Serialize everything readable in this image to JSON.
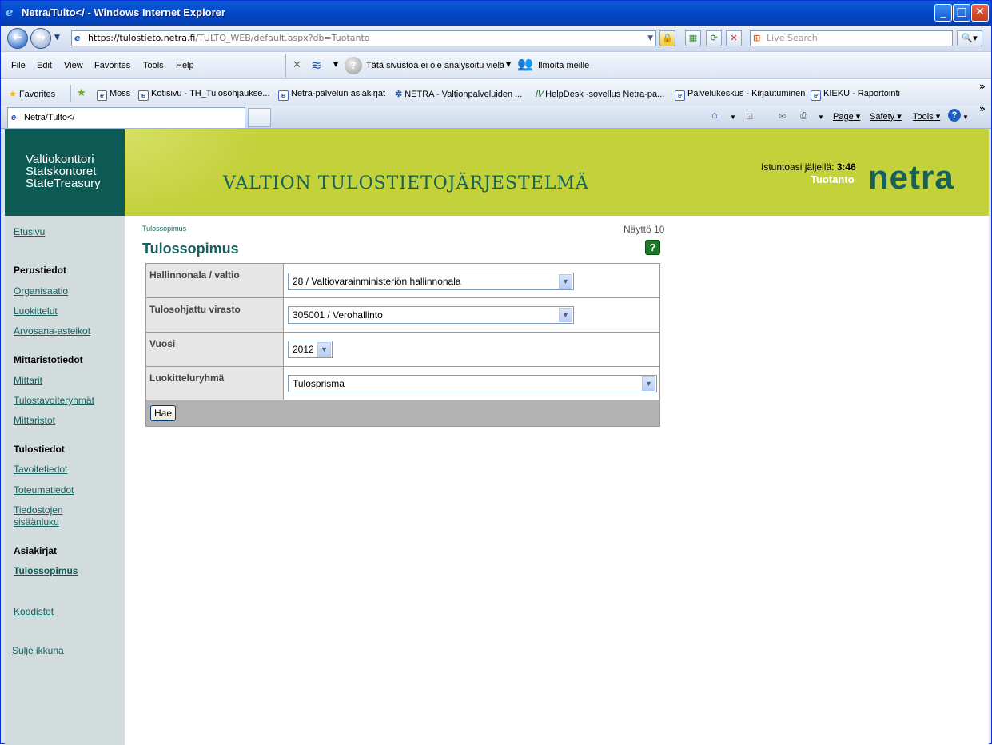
{
  "window": {
    "title": "Netra/Tulto</ - Windows Internet Explorer"
  },
  "address": {
    "host": "https://tulostieto.netra.fi",
    "path": "/TULTO_WEB/default.aspx?db=Tuotanto"
  },
  "search": {
    "placeholder": "Live Search"
  },
  "menu": {
    "file": "File",
    "edit": "Edit",
    "view": "View",
    "favorites": "Favorites",
    "tools": "Tools",
    "help": "Help"
  },
  "toolbar": {
    "analysis": "Tätä sivustoa ei ole analysoitu vielä",
    "report": "Ilmoita meille"
  },
  "favorites": {
    "label": "Favorites",
    "items": [
      "Moss",
      "Kotisivu - TH_Tulosohjaukse...",
      "Netra-palvelun asiakirjat",
      "NETRA - Valtionpalveluiden ...",
      "HelpDesk -sovellus Netra-pa...",
      "Palvelukeskus - Kirjautuminen",
      "KIEKU - Raportointi"
    ]
  },
  "tab": {
    "title": "Netra/Tulto</"
  },
  "commands": {
    "page": "Page",
    "safety": "Safety",
    "tools": "Tools"
  },
  "banner": {
    "org_line1": "Valtiokonttori",
    "org_line2": "Statskontoret",
    "org_line3": "StateTreasury",
    "headline": "VALTION TULOSTIETOJÄRJESTELMÄ",
    "session_label": "Istuntoasi jäljellä:",
    "session_time": "3:46",
    "environment": "Tuotanto",
    "logo": "netra"
  },
  "sidebar": {
    "home": "Etusivu",
    "sec1": "Perustiedot",
    "organisaatio": "Organisaatio",
    "luokittelut": "Luokittelut",
    "arvosana": "Arvosana-asteikot",
    "sec2": "Mittaristotiedot",
    "mittarit": "Mittarit",
    "tulostavoite": "Tulostavoiteryhmät",
    "mittaristot": "Mittaristot",
    "sec3": "Tulostiedot",
    "tavoitetiedot": "Tavoitetiedot",
    "toteumatiedot": "Toteumatiedot",
    "tiedostojen1": "Tiedostojen",
    "tiedostojen2": "sisäänluku",
    "sec4": "Asiakirjat",
    "tulossopimus": "Tulossopimus",
    "koodistot": "Koodistot",
    "sulje": "Sulje ikkuna"
  },
  "main": {
    "breadcrumb": "Tulossopimus",
    "view_number": "Näyttö 10",
    "title": "Tulossopimus",
    "help": "?",
    "fields": {
      "hallinnonala_label": "Hallinnonala / valtio",
      "hallinnonala_value": "28 / Valtiovarainministeriön hallinnonala",
      "virasto_label": "Tulosohjattu virasto",
      "virasto_value": "305001 / Verohallinto",
      "vuosi_label": "Vuosi",
      "vuosi_value": "2012",
      "luokittelu_label": "Luokitteluryhmä",
      "luokittelu_value": "Tulosprisma"
    },
    "submit": "Hae"
  }
}
